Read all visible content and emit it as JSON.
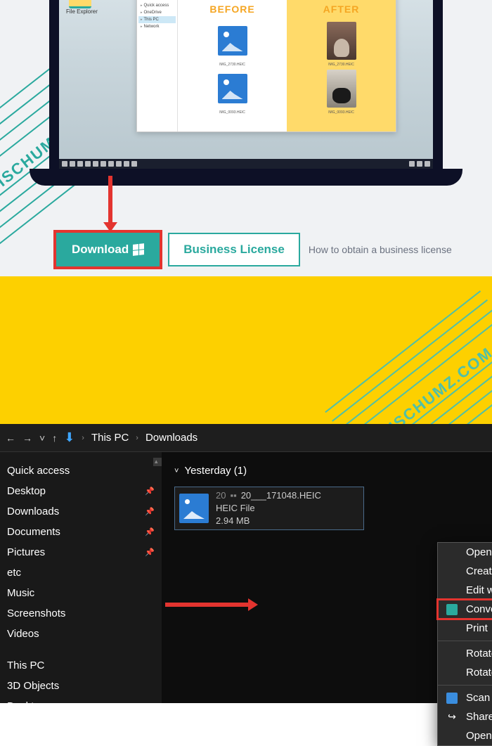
{
  "laptop": {
    "file_explorer_label": "File Explorer",
    "sidebar": [
      "Quick access",
      "OneDrive",
      "This PC",
      "Network"
    ],
    "before_label": "BEFORE",
    "after_label": "AFTER",
    "thumb1_label": "IMG_2730.HEIC",
    "thumb2_label": "IMG_0093.HEIC",
    "thumb3_label": "IMG_2730.HEIC",
    "thumb4_label": "IMG_0093.HEIC"
  },
  "buttons": {
    "download": "Download",
    "business": "Business License",
    "license_link": "How to obtain a business license"
  },
  "watermark": "TECHSCHUMZ.COM",
  "explorer": {
    "breadcrumb_pc": "This PC",
    "breadcrumb_dl": "Downloads",
    "sidebar": {
      "quick": "Quick access",
      "desktop": "Desktop",
      "downloads": "Downloads",
      "documents": "Documents",
      "pictures": "Pictures",
      "etc": "etc",
      "music": "Music",
      "screenshots": "Screenshots",
      "videos": "Videos",
      "thispc": "This PC",
      "objects3d": "3D Objects",
      "desktop2": "Desktop"
    },
    "group": "Yesterday (1)",
    "file": {
      "name": "20___171048.HEIC",
      "type": "HEIC File",
      "size": "2.94 MB"
    },
    "menu": {
      "open": "Open",
      "create_video": "Create a new video",
      "edit_photos": "Edit with Photos",
      "convert": "Convert to JPEG with CopyTrans",
      "print": "Print",
      "rotate_right": "Rotate right",
      "rotate_left": "Rotate left",
      "scan": "Scan with Windows Defender...",
      "share": "Share",
      "open_with": "Open with"
    }
  }
}
